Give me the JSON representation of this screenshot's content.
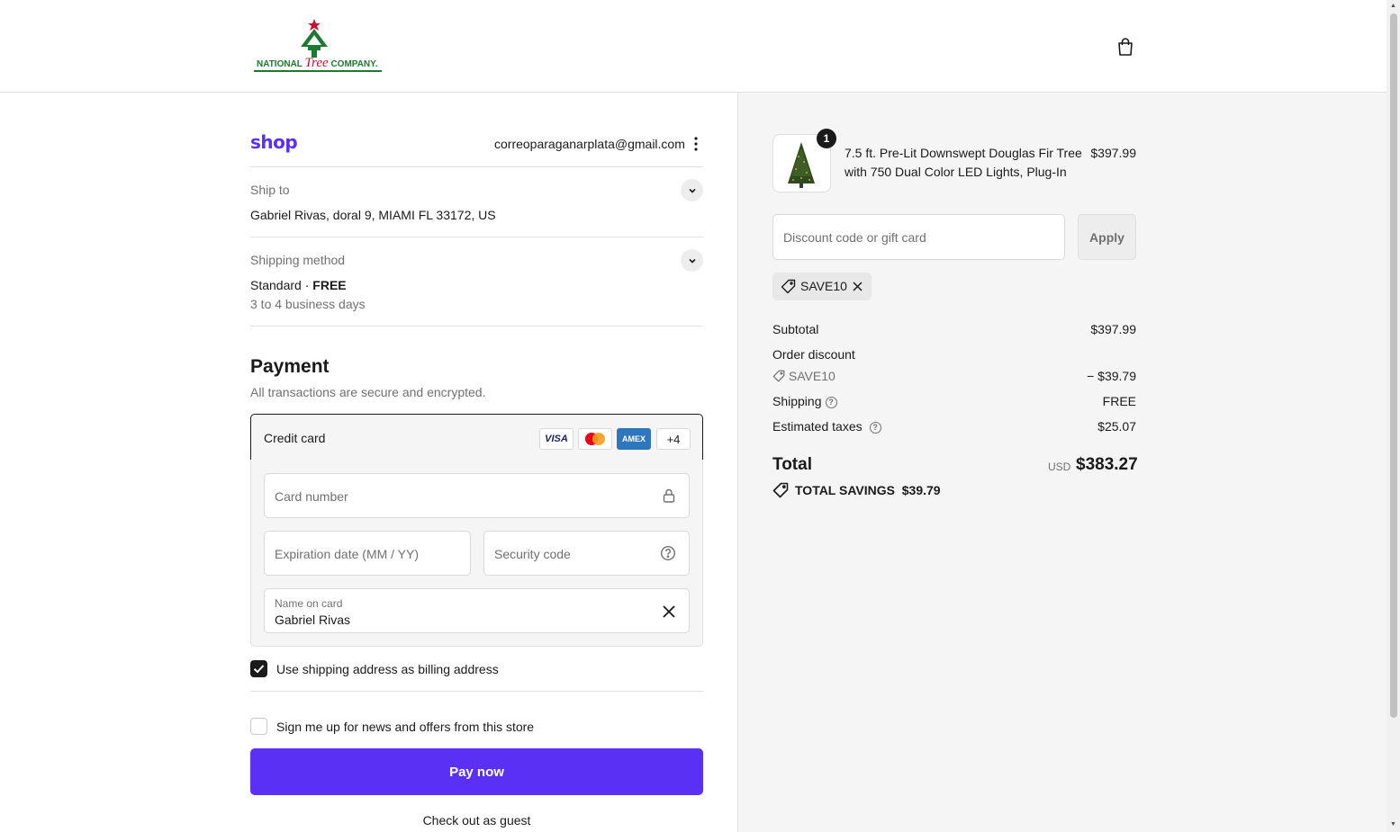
{
  "brand": {
    "logo_word_left": "NATIONAL",
    "logo_word_tree": "Tree",
    "logo_word_right": "COMPANY.",
    "logo_green": "#1b7a2f",
    "logo_red": "#c8102e"
  },
  "account": {
    "shop_logo": "shop",
    "email": "correoparaganarplata@gmail.com"
  },
  "ship_to": {
    "label": "Ship to",
    "value": "Gabriel Rivas, doral 9, MIAMI FL 33172, US"
  },
  "shipping_method": {
    "label": "Shipping method",
    "name": "Standard",
    "separator": " · ",
    "price": "FREE",
    "eta": "3 to 4 business days"
  },
  "payment": {
    "title": "Payment",
    "subtitle": "All transactions are secure and encrypted.",
    "method_label": "Credit card",
    "cards": [
      "VISA",
      "mastercard",
      "AMEX"
    ],
    "more_cards": "+4",
    "card_number_placeholder": "Card number",
    "expiration_placeholder": "Expiration date (MM / YY)",
    "security_placeholder": "Security code",
    "name_label": "Name on card",
    "name_value": "Gabriel Rivas"
  },
  "billing_checkbox": {
    "label": "Use shipping address as billing address",
    "checked": true
  },
  "news_checkbox": {
    "label": "Sign me up for news and offers from this store",
    "checked": false
  },
  "pay_button": "Pay now",
  "guest_link": "Check out as guest",
  "accent_color": "#5a31f4",
  "summary": {
    "product": {
      "quantity": "1",
      "name": "7.5 ft. Pre-Lit Downswept Douglas Fir Tree with 750 Dual Color LED Lights, Plug-In",
      "price": "$397.99"
    },
    "discount_placeholder": "Discount code or gift card",
    "apply_label": "Apply",
    "applied_code": "SAVE10",
    "subtotal_label": "Subtotal",
    "subtotal_value": "$397.99",
    "order_discount_label": "Order discount",
    "discount_code": "SAVE10",
    "discount_value": "− $39.79",
    "shipping_label": "Shipping",
    "shipping_value": "FREE",
    "taxes_label": "Estimated taxes",
    "taxes_value": "$25.07",
    "total_label": "Total",
    "currency": "USD",
    "total_value": "$383.27",
    "savings_label": "TOTAL SAVINGS",
    "savings_value": "$39.79"
  }
}
